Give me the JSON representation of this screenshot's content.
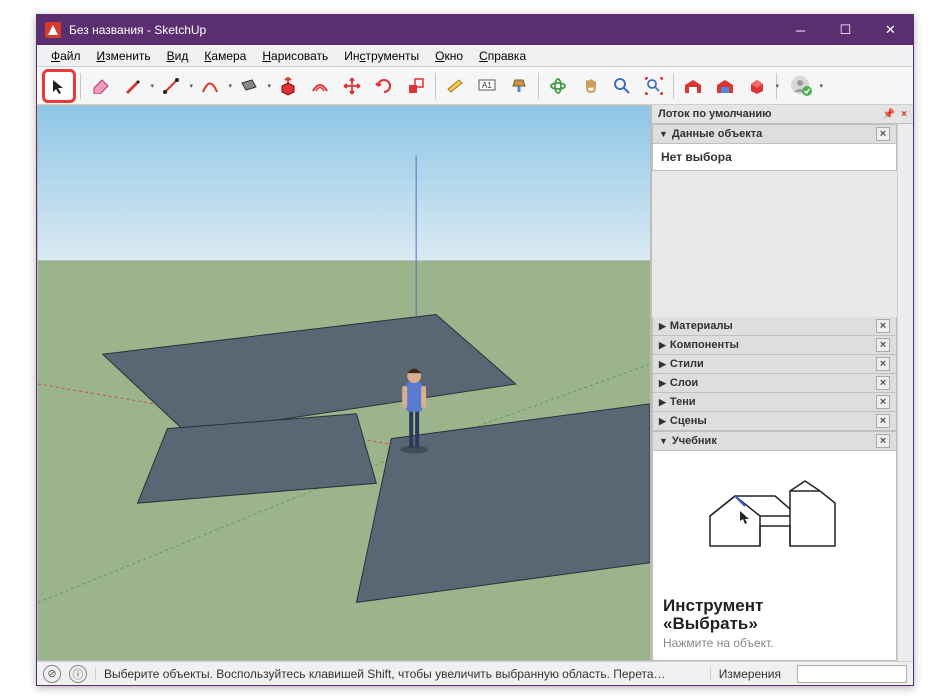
{
  "window": {
    "title": "Без названия - SketchUp"
  },
  "menu": {
    "file": "Файл",
    "file_u": "Ф",
    "edit": "Изменить",
    "edit_u": "И",
    "view": "Вид",
    "view_u": "В",
    "camera": "Камера",
    "camera_u": "К",
    "draw": "Нарисовать",
    "draw_u": "Н",
    "tools": "Инструменты",
    "tools_u": "с",
    "window": "Окно",
    "window_u": "О",
    "help": "Справка",
    "help_u": "С"
  },
  "toolbar": {
    "icons": [
      "select",
      "eraser",
      "pencil",
      "line2",
      "arc",
      "rect",
      "pushpull",
      "offset",
      "move",
      "rotate",
      "scale",
      "tape",
      "text",
      "paint",
      "orbit",
      "pan",
      "zoom",
      "zoomext",
      "sep",
      "wh-red",
      "wh-blue",
      "gem",
      "sep",
      "user"
    ]
  },
  "tray": {
    "title": "Лоток по умолчанию",
    "entity": {
      "title": "Данные объекта",
      "empty": "Нет выбора"
    },
    "panels": [
      "Материалы",
      "Компоненты",
      "Стили",
      "Слои",
      "Тени",
      "Сцены"
    ],
    "tutor": {
      "title": "Учебник",
      "tool_name_l1": "Инструмент",
      "tool_name_l2": "«Выбрать»",
      "hint": "Нажмите на объект."
    }
  },
  "status": {
    "hint": "Выберите объекты. Воспользуйтесь клавишей Shift, чтобы увеличить выбранную область. Перета…",
    "measure_label": "Измерения"
  }
}
